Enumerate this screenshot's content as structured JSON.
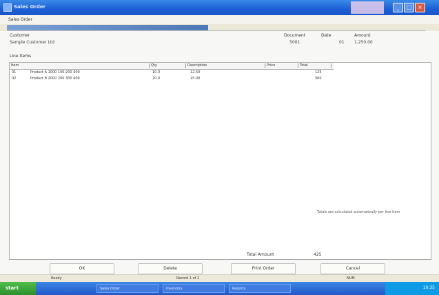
{
  "window": {
    "title": "Sales Order"
  },
  "menubar": {
    "label": "Sales Order"
  },
  "header": {
    "customer_label": "Customer",
    "customer_value": "Sample Customer Ltd",
    "number_label": "Document",
    "number_value": "5001",
    "date_label": "Date",
    "date_value": "01",
    "amount_label": "Amount",
    "amount_value": "1,250.00",
    "items_label": "Line Items"
  },
  "table": {
    "columns": [
      "Item",
      "Qty",
      "Description",
      "Price",
      "Total"
    ],
    "rows": [
      [
        "01",
        "Product A 1000 100 200 300",
        "10.0",
        "12.50",
        "125"
      ],
      [
        "02",
        "Product B 2000 200 300 400",
        "20.0",
        "15.00",
        "300"
      ]
    ]
  },
  "note": "Totals are calculated automatically per line item",
  "totals": {
    "label": "Total Amount",
    "value": "425"
  },
  "buttons": {
    "ok": "OK",
    "delete": "Delete",
    "print": "Print Order",
    "cancel": "Cancel"
  },
  "status": {
    "left": "Ready",
    "center": "Record 1 of 2",
    "right": "NUM"
  },
  "taskbar": {
    "start": "start",
    "items": [
      "Sales Order",
      "Inventory",
      "Reports"
    ],
    "clock": "10:35"
  },
  "progress": {
    "fraction": 0.48
  }
}
